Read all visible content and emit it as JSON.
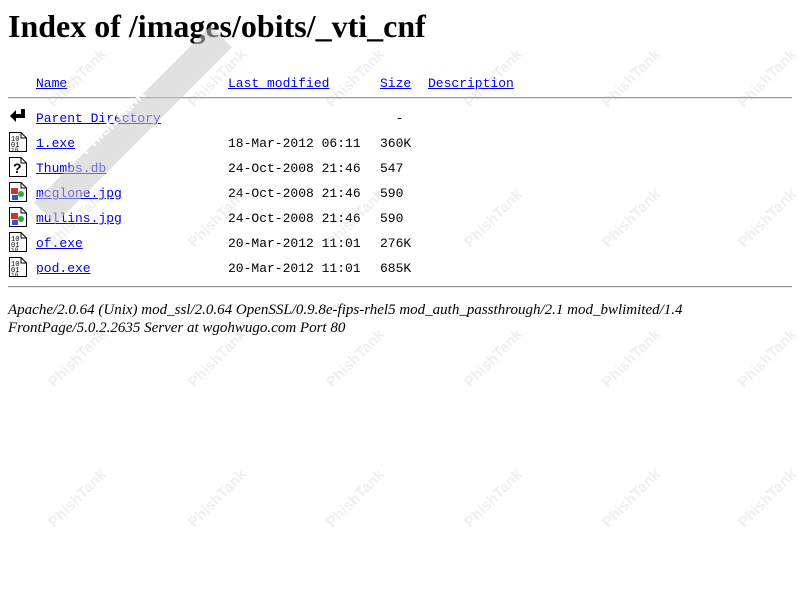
{
  "page": {
    "title": "Index of /images/obits/_vti_cnf"
  },
  "table_header": {
    "name": "Name",
    "last_modified": "Last modified",
    "size": "Size",
    "description": "Description"
  },
  "entries": [
    {
      "icon": "back-icon",
      "name": "Parent Directory",
      "date": "",
      "size": "  -"
    },
    {
      "icon": "binary-icon",
      "name": "1.exe",
      "date": "18-Mar-2012 06:11",
      "size": "360K"
    },
    {
      "icon": "unknown-icon",
      "name": "Thumbs.db",
      "date": "24-Oct-2008 21:46",
      "size": "547"
    },
    {
      "icon": "image-icon",
      "name": "mcglone.jpg",
      "date": "24-Oct-2008 21:46",
      "size": "590"
    },
    {
      "icon": "image-icon",
      "name": "mullins.jpg",
      "date": "24-Oct-2008 21:46",
      "size": "590"
    },
    {
      "icon": "binary-icon",
      "name": "of.exe",
      "date": "20-Mar-2012 11:01",
      "size": "276K"
    },
    {
      "icon": "binary-icon",
      "name": "pod.exe",
      "date": "20-Mar-2012 11:01",
      "size": "685K"
    }
  ],
  "footer": {
    "line1": "Apache/2.0.64 (Unix) mod_ssl/2.0.64 OpenSSL/0.9.8e-fips-rhel5 mod_auth_passthrough/2.1 mod_bwlimited/1.4",
    "line2": "FrontPage/5.0.2.2635 Server at wgohwugo.com Port 80"
  },
  "watermark": {
    "text": "PhishTank"
  },
  "colors": {
    "link": "#0000ee",
    "rule": "#999999"
  }
}
